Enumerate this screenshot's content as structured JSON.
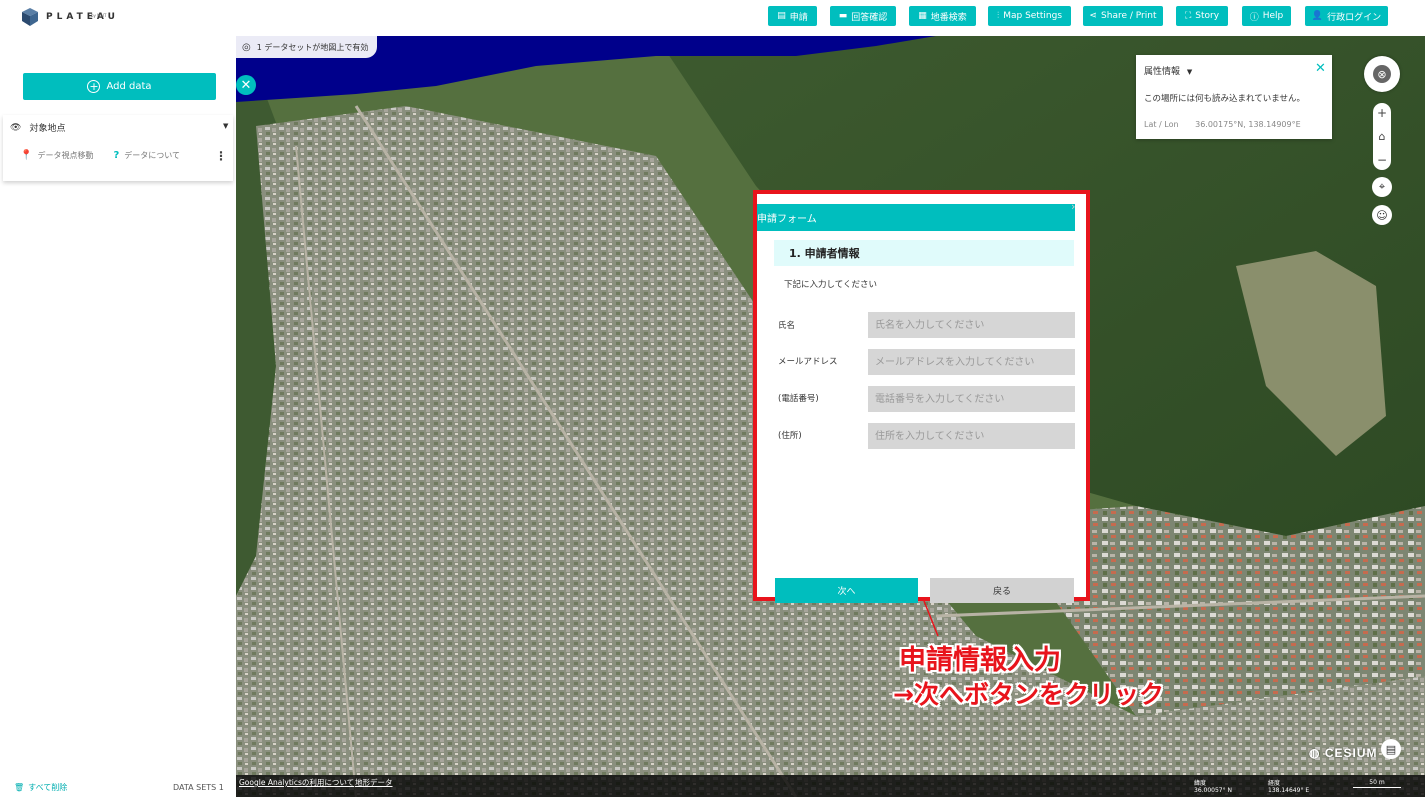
{
  "header": {
    "logo_text": "PLATEAU",
    "logo_sub": "by MLIT",
    "buttons": [
      {
        "label": "申請",
        "icon": "document-icon"
      },
      {
        "label": "回答確認",
        "icon": "chat-icon"
      },
      {
        "label": "地番検索",
        "icon": "building-icon"
      },
      {
        "label": "Map Settings",
        "icon": "sliders-icon"
      },
      {
        "label": "Share / Print",
        "icon": "share-icon"
      },
      {
        "label": "Story",
        "icon": "story-icon"
      },
      {
        "label": "Help",
        "icon": "help-icon"
      },
      {
        "label": "行政ログイン",
        "icon": "user-icon"
      }
    ]
  },
  "sidebar": {
    "add_data_label": "Add data",
    "dataset": {
      "title": "対象地点",
      "action_move": "データ視点移動",
      "action_about": "データについて"
    },
    "delete_all_label": "すべて削除",
    "datasets_count_label": "DATA SETS 1"
  },
  "map": {
    "active_pill": "1 データセットが地図上で有効",
    "attr_panel": {
      "title": "属性情報",
      "message": "この場所には何も読み込まれていません。",
      "latlon_label": "Lat / Lon",
      "latlon_value": "36.00175°N, 138.14909°E"
    },
    "bottom_links": [
      "Google Analyticsの利用について",
      "地形データ"
    ],
    "lat_label": "緯度",
    "lat_value": "36.00057° N",
    "lon_label": "経度",
    "lon_value": "138.14649° E",
    "scale_label": "50 m",
    "cesium_label": "CESIUM"
  },
  "form": {
    "header_title": "申請フォーム",
    "section_title": "1. 申請者情報",
    "note": "下記に入力してください",
    "fields": [
      {
        "label": "氏名",
        "placeholder": "氏名を入力してください"
      },
      {
        "label": "メールアドレス",
        "placeholder": "メールアドレスを入力してください"
      },
      {
        "label": "(電話番号)",
        "placeholder": "電話番号を入力してください"
      },
      {
        "label": "(住所)",
        "placeholder": "住所を入力してください"
      }
    ],
    "next_label": "次へ",
    "back_label": "戻る"
  },
  "annotation": {
    "line1": "申請情報入力",
    "line2": "→次へボタンをクリック"
  },
  "colors": {
    "accent": "#00bebe",
    "highlight_red": "#e8141c",
    "water": "#00008b"
  }
}
